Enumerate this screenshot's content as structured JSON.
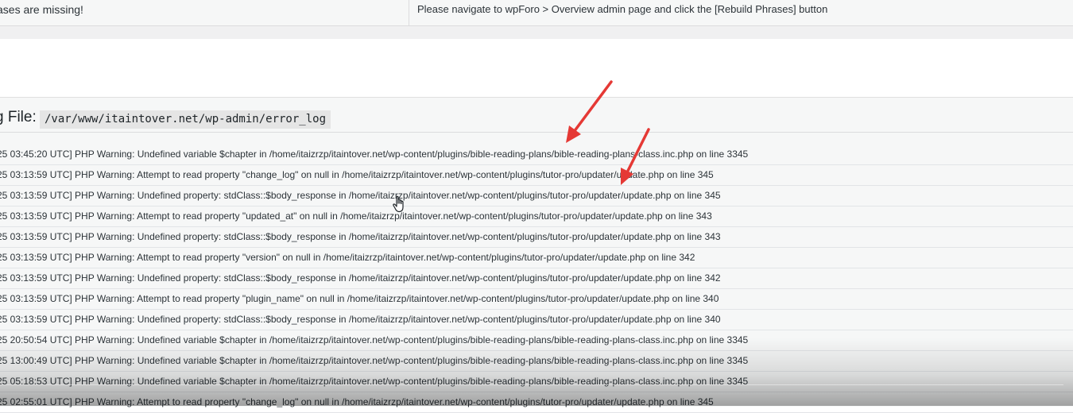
{
  "status": {
    "left_text": "ases are missing!",
    "right_text": "Please navigate to wpForo > Overview admin page and click the [Rebuild Phrases] button"
  },
  "log": {
    "header_label": "g File:",
    "file_path": "/var/www/itaintover.net/wp-admin/error_log",
    "lines": [
      "25 03:45:20 UTC] PHP Warning:  Undefined variable $chapter in /home/itaizrzp/itaintover.net/wp-content/plugins/bible-reading-plans/bible-reading-plans-class.inc.php on line 3345",
      "25 03:13:59 UTC] PHP Warning:  Attempt to read property \"change_log\" on null in /home/itaizrzp/itaintover.net/wp-content/plugins/tutor-pro/updater/update.php on line 345",
      "25 03:13:59 UTC] PHP Warning:  Undefined property: stdClass::$body_response in /home/itaizrzp/itaintover.net/wp-content/plugins/tutor-pro/updater/update.php on line 345",
      "25 03:13:59 UTC] PHP Warning:  Attempt to read property \"updated_at\" on null in /home/itaizrzp/itaintover.net/wp-content/plugins/tutor-pro/updater/update.php on line 343",
      "25 03:13:59 UTC] PHP Warning:  Undefined property: stdClass::$body_response in /home/itaizrzp/itaintover.net/wp-content/plugins/tutor-pro/updater/update.php on line 343",
      "25 03:13:59 UTC] PHP Warning:  Attempt to read property \"version\" on null in /home/itaizrzp/itaintover.net/wp-content/plugins/tutor-pro/updater/update.php on line 342",
      "25 03:13:59 UTC] PHP Warning:  Undefined property: stdClass::$body_response in /home/itaizrzp/itaintover.net/wp-content/plugins/tutor-pro/updater/update.php on line 342",
      "25 03:13:59 UTC] PHP Warning:  Attempt to read property \"plugin_name\" on null in /home/itaizrzp/itaintover.net/wp-content/plugins/tutor-pro/updater/update.php on line 340",
      "25 03:13:59 UTC] PHP Warning:  Undefined property: stdClass::$body_response in /home/itaizrzp/itaintover.net/wp-content/plugins/tutor-pro/updater/update.php on line 340",
      "25 20:50:54 UTC] PHP Warning:  Undefined variable $chapter in /home/itaizrzp/itaintover.net/wp-content/plugins/bible-reading-plans/bible-reading-plans-class.inc.php on line 3345",
      "25 13:00:49 UTC] PHP Warning:  Undefined variable $chapter in /home/itaizrzp/itaintover.net/wp-content/plugins/bible-reading-plans/bible-reading-plans-class.inc.php on line 3345",
      "25 05:18:53 UTC] PHP Warning:  Undefined variable $chapter in /home/itaizrzp/itaintover.net/wp-content/plugins/bible-reading-plans/bible-reading-plans-class.inc.php on line 3345",
      "25 02:55:01 UTC] PHP Warning:  Attempt to read property \"change_log\" on null in /home/itaizrzp/itaintover.net/wp-content/plugins/tutor-pro/updater/update.php on line 345"
    ]
  },
  "annotations": {
    "arrow_color": "#e53935",
    "arrow_count": 2
  },
  "cursor": {
    "icon": "hand-pointer-icon"
  }
}
